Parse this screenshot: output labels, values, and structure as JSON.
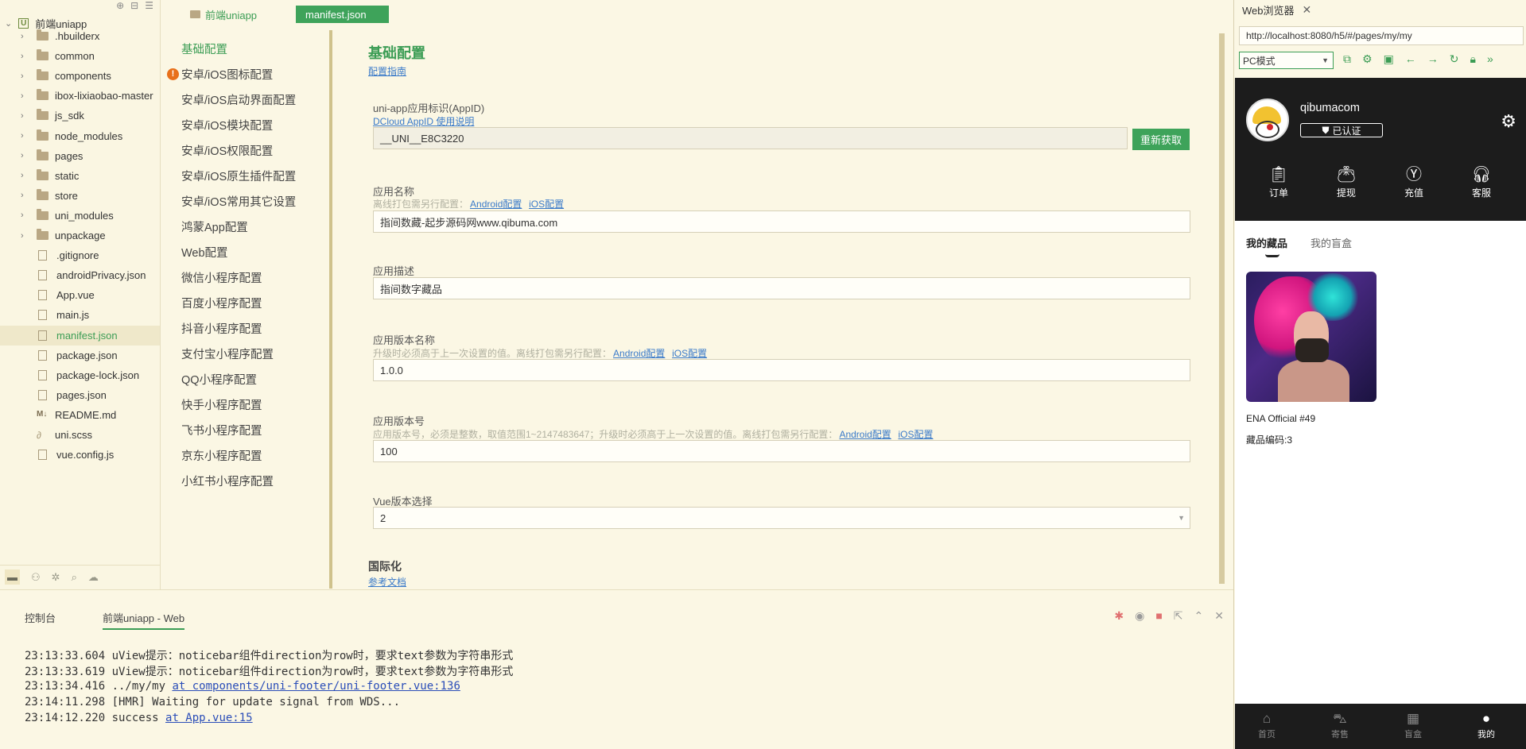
{
  "tree": {
    "root": "前端uniapp",
    "items": [
      {
        "label": ".hbuilderx",
        "type": "folder"
      },
      {
        "label": "common",
        "type": "folder"
      },
      {
        "label": "components",
        "type": "folder"
      },
      {
        "label": "ibox-lixiaobao-master",
        "type": "folder"
      },
      {
        "label": "js_sdk",
        "type": "folder"
      },
      {
        "label": "node_modules",
        "type": "folder"
      },
      {
        "label": "pages",
        "type": "folder"
      },
      {
        "label": "static",
        "type": "folder"
      },
      {
        "label": "store",
        "type": "folder"
      },
      {
        "label": "uni_modules",
        "type": "folder"
      },
      {
        "label": "unpackage",
        "type": "folder"
      },
      {
        "label": ".gitignore",
        "type": "file"
      },
      {
        "label": "androidPrivacy.json",
        "type": "file"
      },
      {
        "label": "App.vue",
        "type": "file"
      },
      {
        "label": "main.js",
        "type": "file"
      },
      {
        "label": "manifest.json",
        "type": "file",
        "active": true
      },
      {
        "label": "package.json",
        "type": "file"
      },
      {
        "label": "package-lock.json",
        "type": "file"
      },
      {
        "label": "pages.json",
        "type": "file"
      },
      {
        "label": "README.md",
        "type": "md"
      },
      {
        "label": "uni.scss",
        "type": "scss"
      },
      {
        "label": "vue.config.js",
        "type": "file"
      }
    ]
  },
  "editor_tabs": {
    "project": "前端uniapp",
    "file": "manifest.json"
  },
  "config_nav": [
    {
      "label": "基础配置",
      "active": true
    },
    {
      "label": "安卓/iOS图标配置",
      "warn": true
    },
    {
      "label": "安卓/iOS启动界面配置"
    },
    {
      "label": "安卓/iOS模块配置"
    },
    {
      "label": "安卓/iOS权限配置"
    },
    {
      "label": "安卓/iOS原生插件配置"
    },
    {
      "label": "安卓/iOS常用其它设置"
    },
    {
      "label": "鸿蒙App配置"
    },
    {
      "label": "Web配置"
    },
    {
      "label": "微信小程序配置"
    },
    {
      "label": "百度小程序配置"
    },
    {
      "label": "抖音小程序配置"
    },
    {
      "label": "支付宝小程序配置"
    },
    {
      "label": "QQ小程序配置"
    },
    {
      "label": "快手小程序配置"
    },
    {
      "label": "飞书小程序配置"
    },
    {
      "label": "京东小程序配置"
    },
    {
      "label": "小红书小程序配置"
    }
  ],
  "form": {
    "title": "基础配置",
    "guide_link": "配置指南",
    "appid_label": "uni-app应用标识(AppID)",
    "appid_link": "DCloud AppID 使用说明",
    "appid_value": "__UNI__E8C3220",
    "refresh_button": "重新获取",
    "name_label": "应用名称",
    "name_hint": "离线打包需另行配置：",
    "android_link": "Android配置",
    "ios_link": "iOS配置",
    "name_value": "指间数藏-起步源码网www.qibuma.com",
    "desc_label": "应用描述",
    "desc_value": "指间数字藏品",
    "version_name_label": "应用版本名称",
    "version_name_hint": "升级时必须高于上一次设置的值。离线打包需另行配置：",
    "version_name_value": "1.0.0",
    "version_code_label": "应用版本号",
    "version_code_hint": "应用版本号，必须是整数，取值范围1~2147483647；升级时必须高于上一次设置的值。离线打包需另行配置：",
    "version_code_value": "100",
    "vue_label": "Vue版本选择",
    "vue_value": "2",
    "i18n_title": "国际化",
    "i18n_link": "参考文档"
  },
  "console": {
    "tabs": [
      "控制台",
      "前端uniapp - Web"
    ],
    "lines": [
      {
        "text": "23:13:33.604 uView提示：noticebar组件direction为row时，要求text参数为字符串形式",
        "link": ""
      },
      {
        "text": "23:13:33.619 uView提示：noticebar组件direction为row时，要求text参数为字符串形式",
        "link": ""
      },
      {
        "text": "23:13:34.416 ../my/my ",
        "link": "at components/uni-footer/uni-footer.vue:136"
      },
      {
        "text": "23:14:11.298 [HMR] Waiting for update signal from WDS...",
        "link": ""
      },
      {
        "text": "23:14:12.220 success ",
        "link": "at App.vue:15"
      }
    ]
  },
  "browser": {
    "tab_title": "Web浏览器",
    "url": "http://localhost:8080/h5/#/pages/my/my",
    "mode": "PC模式"
  },
  "phone": {
    "username": "qibumacom",
    "verified": "已认证",
    "actions": [
      "订单",
      "提现",
      "充值",
      "客服"
    ],
    "tabs": [
      "我的藏品",
      "我的盲盒"
    ],
    "nft_name": "ENA Official #49",
    "nft_code": "藏品编码:3",
    "bottom_nav": [
      "首页",
      "寄售",
      "盲盒",
      "我的"
    ]
  },
  "colors": {
    "accent": "#3ea35a",
    "link": "#3a7ac9",
    "warn": "#e8701a"
  }
}
